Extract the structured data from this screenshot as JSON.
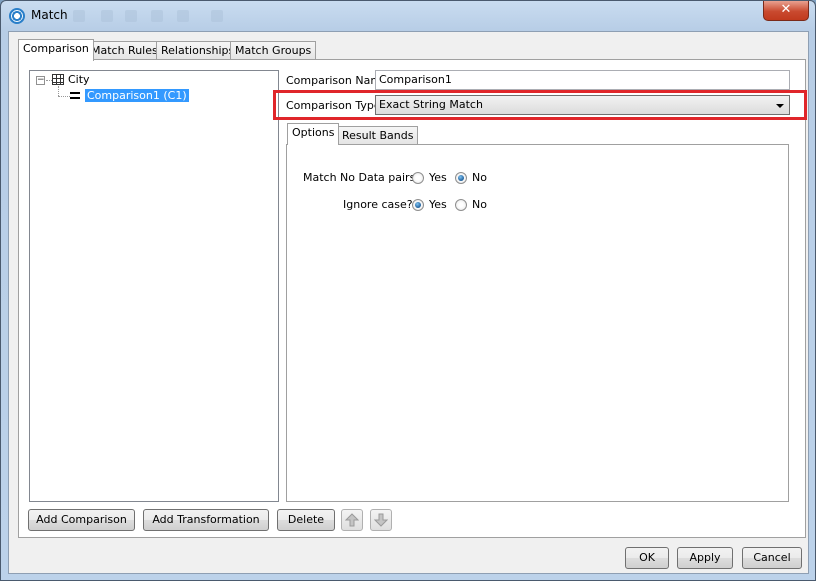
{
  "window": {
    "title": "Match",
    "close_glyph": "✕"
  },
  "tabs": [
    {
      "label": "Comparison"
    },
    {
      "label": "Match Rules"
    },
    {
      "label": "Relationships"
    },
    {
      "label": "Match Groups"
    }
  ],
  "tree": {
    "root": {
      "label": "City",
      "expander": "−",
      "icon": "table-grid-icon"
    },
    "child": {
      "label": "Comparison1 (C1)",
      "icon": "equals-icon"
    }
  },
  "form": {
    "name_label": "Comparison Name",
    "name_value": "Comparison1",
    "type_label": "Comparison Type",
    "type_value": "Exact String Match"
  },
  "inner_tabs": [
    {
      "label": "Options"
    },
    {
      "label": "Result Bands"
    }
  ],
  "options": {
    "match_no_data": {
      "label": "Match No Data pairs?",
      "yes": "Yes",
      "no": "No",
      "selected": "No"
    },
    "ignore_case": {
      "label": "Ignore case?",
      "yes": "Yes",
      "no": "No",
      "selected": "Yes"
    }
  },
  "actions": {
    "add_comparison": "Add Comparison",
    "add_transformation": "Add Transformation",
    "delete": "Delete"
  },
  "dialog_buttons": {
    "ok": "OK",
    "apply": "Apply",
    "cancel": "Cancel"
  },
  "colors": {
    "highlight": "#e0262a",
    "selection": "#3399ff"
  }
}
